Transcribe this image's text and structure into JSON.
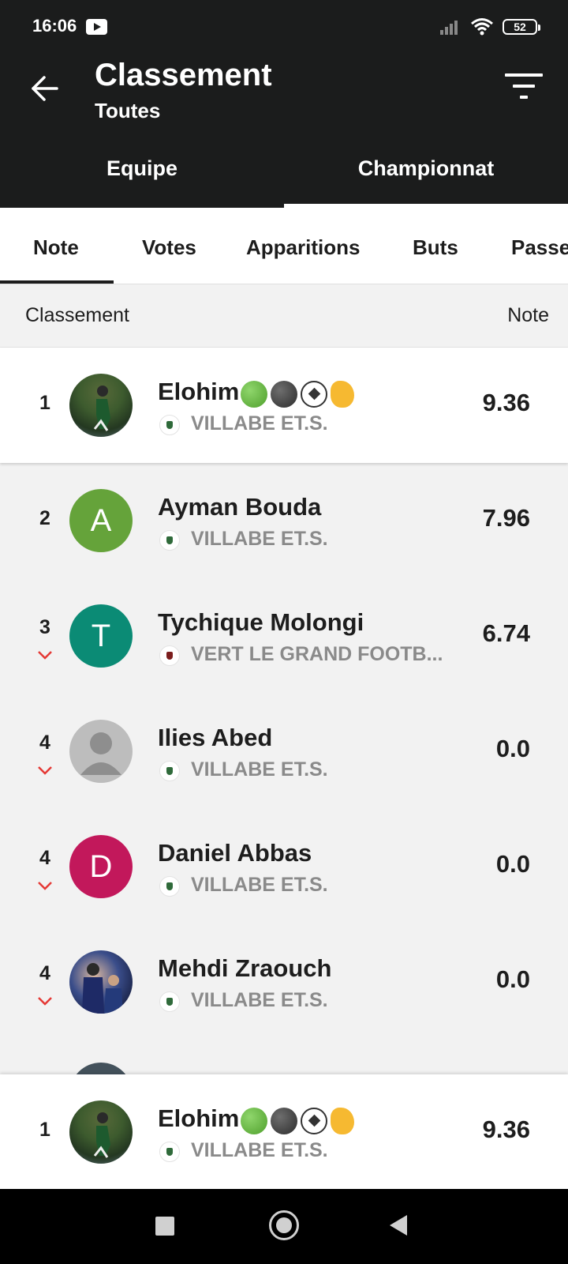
{
  "status_bar": {
    "time": "16:06",
    "battery": "52"
  },
  "header": {
    "title": "Classement",
    "subtitle": "Toutes"
  },
  "main_tabs": [
    "Equipe",
    "Championnat"
  ],
  "sub_tabs": [
    "Note",
    "Votes",
    "Apparitions",
    "Buts",
    "Passe"
  ],
  "columns": {
    "left": "Classement",
    "right": "Note"
  },
  "players": [
    {
      "rank": "1",
      "name": "Elohim",
      "emojis": [
        "green-circle",
        "black-circle",
        "soccer-ball",
        "hand"
      ],
      "club": "VILLABE ET.S.",
      "score": "9.36",
      "avatar": "photo",
      "highlight": true
    },
    {
      "rank": "2",
      "name": "Ayman Bouda",
      "club": "VILLABE ET.S.",
      "score": "7.96",
      "avatar_letter": "A",
      "avatar_color": "#65a33a"
    },
    {
      "rank": "3",
      "name": "Tychique Molongi",
      "club": "VERT LE GRAND FOOTB...",
      "score": "6.74",
      "avatar_letter": "T",
      "avatar_color": "#0b8b75",
      "trend": "down"
    },
    {
      "rank": "4",
      "name": "Ilies Abed",
      "club": "VILLABE ET.S.",
      "score": "0.0",
      "avatar": "default",
      "trend": "down"
    },
    {
      "rank": "4",
      "name": "Daniel Abbas",
      "club": "VILLABE ET.S.",
      "score": "0.0",
      "avatar_letter": "D",
      "avatar_color": "#c2185b",
      "trend": "down"
    },
    {
      "rank": "4",
      "name": "Mehdi Zraouch",
      "club": "VILLABE ET.S.",
      "score": "0.0",
      "avatar": "photo",
      "trend": "down"
    }
  ],
  "current_user": {
    "rank": "1",
    "name": "Elohim",
    "club": "VILLABE ET.S.",
    "score": "9.36"
  },
  "colors": {
    "dark": "#1b1c1c",
    "trend_down": "#e53935",
    "club_text": "#8a8a8a"
  }
}
